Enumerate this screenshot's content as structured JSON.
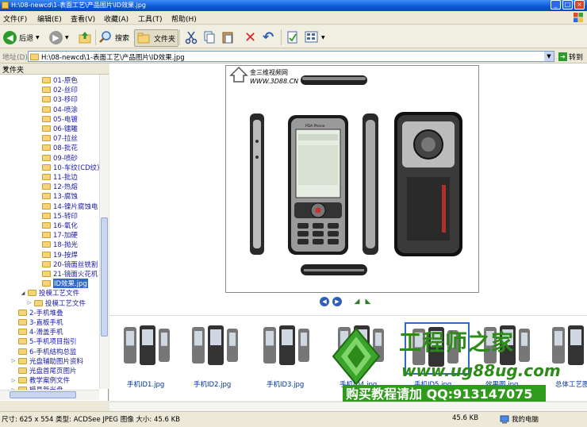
{
  "window": {
    "title": "H:\\08-newcd\\1-表面工艺\\产品图片\\ID效果.jpg"
  },
  "menu": {
    "items": [
      "文件(F)",
      "编辑(E)",
      "查看(V)",
      "收藏(A)",
      "工具(T)",
      "帮助(H)"
    ]
  },
  "toolbar": {
    "back_label": "后退",
    "search_label": "搜索",
    "folders_label": "文件夹"
  },
  "address": {
    "label": "地址(D)",
    "value": "H:\\08-newcd\\1-表面工艺\\产品图片\\ID效果.jpg",
    "go_label": "转到"
  },
  "folder_pane": {
    "title": "文件夹",
    "close": "×",
    "items": [
      "01-原色",
      "02-丝印",
      "03-移印",
      "04-喷涂",
      "05-电镀",
      "06-镭雕",
      "07-拉丝",
      "08-批花",
      "09-喷砂",
      "10-车纹(CD纹)",
      "11-批边",
      "12-热熔",
      "13-腐蚀",
      "14-镍片腐蚀电",
      "15-转印",
      "16-氧化",
      "17-加硬",
      "18-抛光",
      "19-按焊",
      "20-镜面丝铣割",
      "21-镜面火花机",
      "ID效果.jpg"
    ],
    "sub_items": [
      "投模工艺文件",
      "投模工艺文件"
    ],
    "root_items": [
      "2-手机堆叠",
      "3-直板手机",
      "4-滑盖手机",
      "5-手机项目指引",
      "6-手机结构总监",
      "光盘辅助图片资料",
      "光盘首尾页图片",
      "教学案例文件",
      "模具新光盘"
    ]
  },
  "preview": {
    "site_name": "金三维视频网",
    "site_url": "WWW.3D88.CN",
    "brand_on_phone": "PDA Phone"
  },
  "thumbnails": [
    {
      "label": "手机ID1.jpg"
    },
    {
      "label": "手机ID2.jpg"
    },
    {
      "label": "手机ID3.jpg"
    },
    {
      "label": "手机ID4.jpg"
    },
    {
      "label": "手机ID5.jpg"
    },
    {
      "label": "效果图.jpg"
    },
    {
      "label": "总体工艺图"
    }
  ],
  "watermark": {
    "title": "工程师之家",
    "url": "www.ug88ug.com",
    "buy": "购买教程请加 QQ:913147075"
  },
  "status": {
    "text": "尺寸: 625 x 554 类型: ACDSee JPEG 图像 大小: 45.6 KB",
    "size": "45.6 KB",
    "computer": "我的电脑"
  },
  "colors": {
    "titlebar": "#0b56d8",
    "selection": "#316ac5",
    "watermark_green": "#2e8b1a"
  }
}
